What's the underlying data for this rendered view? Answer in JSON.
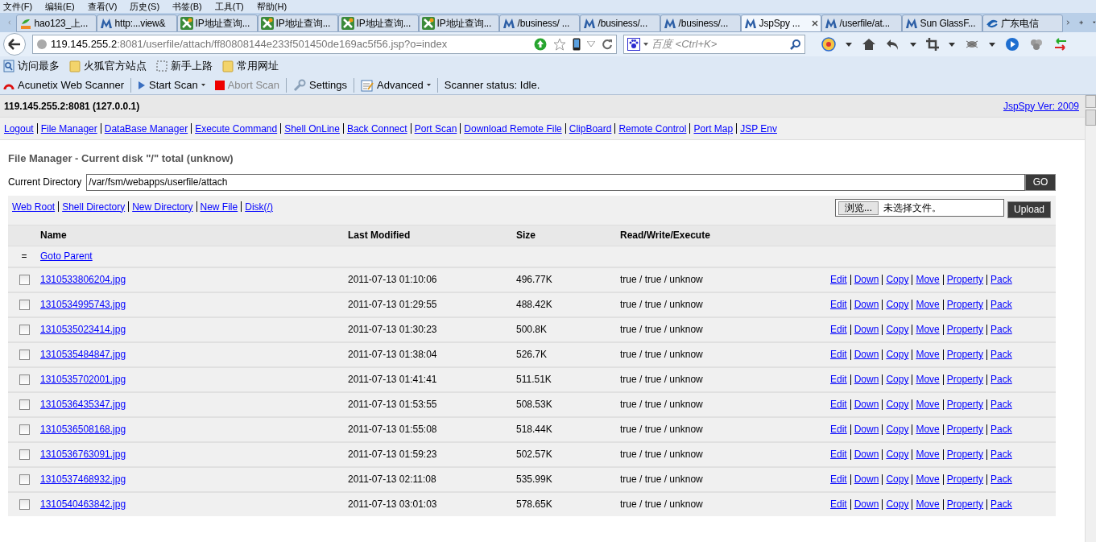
{
  "menu_bar": [
    "文件(F)",
    "编辑(E)",
    "查看(V)",
    "历史(S)",
    "书签(B)",
    "工具(T)",
    "帮助(H)"
  ],
  "tabs": [
    {
      "label": "hao123_上...",
      "kind": "hao",
      "selected": false
    },
    {
      "label": "http:...view&",
      "kind": "m",
      "selected": false
    },
    {
      "label": "IP地址查询...",
      "kind": "ip",
      "selected": false
    },
    {
      "label": "IP地址查询...",
      "kind": "ip",
      "selected": false
    },
    {
      "label": "IP地址查询...",
      "kind": "ip",
      "selected": false
    },
    {
      "label": "IP地址查询...",
      "kind": "ip",
      "selected": false
    },
    {
      "label": "/business/ ...",
      "kind": "m",
      "selected": false
    },
    {
      "label": "/business/...",
      "kind": "m",
      "selected": false
    },
    {
      "label": "/business/...",
      "kind": "m",
      "selected": false
    },
    {
      "label": "JspSpy ...",
      "kind": "m",
      "selected": true
    },
    {
      "label": "/userfile/at...",
      "kind": "m",
      "selected": false
    },
    {
      "label": "Sun GlassF...",
      "kind": "m",
      "selected": false
    },
    {
      "label": "广东电信",
      "kind": "telecom",
      "selected": false
    }
  ],
  "address": {
    "host": "119.145.255.2",
    "rest": ":8081/userfile/attach/ff80808144e233f501450de169ac5f56.jsp?o=index"
  },
  "search": {
    "placeholder": "百度 <Ctrl+K>"
  },
  "bookmarks": [
    {
      "label": "访问最多",
      "kind": "search"
    },
    {
      "label": "火狐官方站点",
      "kind": "folder"
    },
    {
      "label": "新手上路",
      "kind": "dashed"
    },
    {
      "label": "常用网址",
      "kind": "folder"
    }
  ],
  "scanner_toolbar": {
    "title": "Acunetix Web Scanner",
    "start": "Start Scan",
    "abort": "Abort Scan",
    "abort_disabled": true,
    "settings": "Settings",
    "advanced": "Advanced",
    "status": "Scanner status: Idle."
  },
  "page": {
    "host": "119.145.255.2:8081 (127.0.0.1)",
    "version": "JspSpy Ver: 2009",
    "nav": [
      "Logout",
      "File Manager",
      "DataBase Manager",
      "Execute Command",
      "Shell OnLine",
      "Back Connect",
      "Port Scan",
      "Download Remote File",
      "ClipBoard",
      "Remote Control",
      "Port Map",
      "JSP Env"
    ],
    "heading": "File Manager - Current disk \"/\" total (unknow)",
    "directory_label": "Current Directory",
    "directory": "/var/fsm/webapps/userfile/attach",
    "go": "GO",
    "links": [
      "Web Root",
      "Shell Directory",
      "New Directory",
      "New File",
      "Disk(/)"
    ],
    "browse": "浏览...",
    "no_file": "未选择文件。",
    "upload": "Upload",
    "columns": [
      "Name",
      "Last Modified",
      "Size",
      "Read/Write/Execute"
    ],
    "parent_mark": "=",
    "parent": "Goto Parent",
    "rows": [
      {
        "name": "1310533806204.jpg",
        "modified": "2011-07-13 01:10:06",
        "size": "496.77K",
        "rwx": "true / true / unknow",
        "checked": false,
        "actions": [
          "Edit",
          "Down",
          "Copy",
          "Move",
          "Property",
          "Pack"
        ]
      },
      {
        "name": "1310534995743.jpg",
        "modified": "2011-07-13 01:29:55",
        "size": "488.42K",
        "rwx": "true / true / unknow",
        "checked": false,
        "actions": [
          "Edit",
          "Down",
          "Copy",
          "Move",
          "Property",
          "Pack"
        ]
      },
      {
        "name": "1310535023414.jpg",
        "modified": "2011-07-13 01:30:23",
        "size": "500.8K",
        "rwx": "true / true / unknow",
        "checked": false,
        "actions": [
          "Edit",
          "Down",
          "Copy",
          "Move",
          "Property",
          "Pack"
        ]
      },
      {
        "name": "1310535484847.jpg",
        "modified": "2011-07-13 01:38:04",
        "size": "526.7K",
        "rwx": "true / true / unknow",
        "checked": false,
        "actions": [
          "Edit",
          "Down",
          "Copy",
          "Move",
          "Property",
          "Pack"
        ]
      },
      {
        "name": "1310535702001.jpg",
        "modified": "2011-07-13 01:41:41",
        "size": "511.51K",
        "rwx": "true / true / unknow",
        "checked": false,
        "actions": [
          "Edit",
          "Down",
          "Copy",
          "Move",
          "Property",
          "Pack"
        ]
      },
      {
        "name": "1310536435347.jpg",
        "modified": "2011-07-13 01:53:55",
        "size": "508.53K",
        "rwx": "true / true / unknow",
        "checked": false,
        "actions": [
          "Edit",
          "Down",
          "Copy",
          "Move",
          "Property",
          "Pack"
        ]
      },
      {
        "name": "1310536508168.jpg",
        "modified": "2011-07-13 01:55:08",
        "size": "518.44K",
        "rwx": "true / true / unknow",
        "checked": false,
        "actions": [
          "Edit",
          "Down",
          "Copy",
          "Move",
          "Property",
          "Pack"
        ]
      },
      {
        "name": "1310536763091.jpg",
        "modified": "2011-07-13 01:59:23",
        "size": "502.57K",
        "rwx": "true / true / unknow",
        "checked": false,
        "actions": [
          "Edit",
          "Down",
          "Copy",
          "Move",
          "Property",
          "Pack"
        ]
      },
      {
        "name": "1310537468932.jpg",
        "modified": "2011-07-13 02:11:08",
        "size": "535.99K",
        "rwx": "true / true / unknow",
        "checked": false,
        "actions": [
          "Edit",
          "Down",
          "Copy",
          "Move",
          "Property",
          "Pack"
        ]
      },
      {
        "name": "1310540463842.jpg",
        "modified": "2011-07-13 03:01:03",
        "size": "578.65K",
        "rwx": "true / true / unknow",
        "checked": false,
        "actions": [
          "Edit",
          "Down",
          "Copy",
          "Move",
          "Property",
          "Pack"
        ]
      }
    ]
  }
}
